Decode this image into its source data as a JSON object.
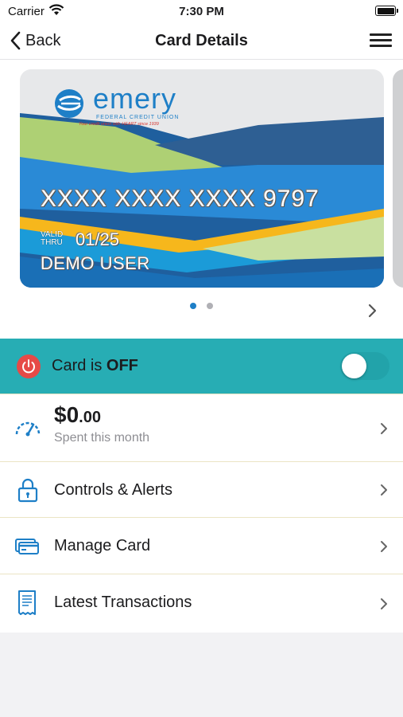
{
  "status_bar": {
    "carrier": "Carrier",
    "time": "7:30 PM"
  },
  "nav": {
    "back_label": "Back",
    "title": "Card Details"
  },
  "card": {
    "bank_name": "emery",
    "bank_subtitle": "FEDERAL CREDIT UNION",
    "tagline": "Your credit union with HEART since 1939",
    "number": "XXXX XXXX XXXX 9797",
    "valid_label": "VALID THRU",
    "expiry": "01/25",
    "holder": "DEMO USER"
  },
  "carousel": {
    "page_count": 2,
    "active_index": 0
  },
  "card_status": {
    "prefix": "Card is ",
    "state": "OFF",
    "enabled": false
  },
  "spending": {
    "dollars": "$0",
    "cents": ".00",
    "label": "Spent this month"
  },
  "menu": [
    {
      "label": "Controls & Alerts",
      "icon": "lock-icon"
    },
    {
      "label": "Manage Card",
      "icon": "card-icon"
    },
    {
      "label": "Latest Transactions",
      "icon": "receipt-icon"
    }
  ],
  "colors": {
    "toggle_bar": "#27adb4",
    "power_button": "#e64a47",
    "icon_blue": "#1e7fc7",
    "active_dot": "#1e7fc7",
    "inactive_dot": "#b0b0b5"
  }
}
